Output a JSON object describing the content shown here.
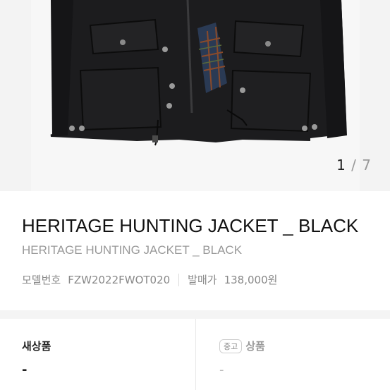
{
  "gallery": {
    "current_page": "1",
    "separator": "/",
    "total_pages": "7"
  },
  "product": {
    "title": "HERITAGE HUNTING JACKET _ BLACK",
    "subtitle": "HERITAGE HUNTING JACKET _ BLACK",
    "model_label": "모델번호",
    "model_number": "FZW2022FWOT020",
    "release_price_label": "발매가",
    "release_price": "138,000원"
  },
  "conditions": {
    "new": {
      "label": "새상품",
      "value": "-"
    },
    "used": {
      "badge": "중고",
      "label": "상품",
      "value": "-"
    }
  }
}
